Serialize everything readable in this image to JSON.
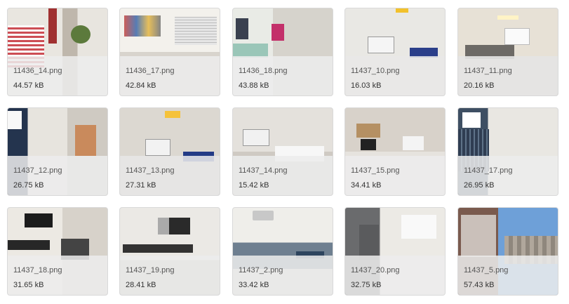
{
  "files": [
    {
      "name": "11436_14.png",
      "size": "44.57 kB",
      "thumb": "bathroom"
    },
    {
      "name": "11436_17.png",
      "size": "42.84 kB",
      "thumb": "study"
    },
    {
      "name": "11436_18.png",
      "size": "43.88 kB",
      "thumb": "bedroom"
    },
    {
      "name": "11437_10.png",
      "size": "16.03 kB",
      "thumb": "room"
    },
    {
      "name": "11437_11.png",
      "size": "20.16 kB",
      "thumb": "living-room"
    },
    {
      "name": "11437_12.png",
      "size": "26.75 kB",
      "thumb": "bathroom"
    },
    {
      "name": "11437_13.png",
      "size": "27.31 kB",
      "thumb": "room"
    },
    {
      "name": "11437_14.png",
      "size": "15.42 kB",
      "thumb": "bedroom"
    },
    {
      "name": "11437_15.png",
      "size": "34.41 kB",
      "thumb": "room"
    },
    {
      "name": "11437_17.png",
      "size": "26.95 kB",
      "thumb": "bathroom"
    },
    {
      "name": "11437_18.png",
      "size": "31.65 kB",
      "thumb": "kitchen"
    },
    {
      "name": "11437_19.png",
      "size": "28.41 kB",
      "thumb": "kitchen"
    },
    {
      "name": "11437_2.png",
      "size": "33.42 kB",
      "thumb": "living-room"
    },
    {
      "name": "11437_20.png",
      "size": "32.75 kB",
      "thumb": "kitchen"
    },
    {
      "name": "11437_5.png",
      "size": "57.43 kB",
      "thumb": "balcony"
    }
  ]
}
